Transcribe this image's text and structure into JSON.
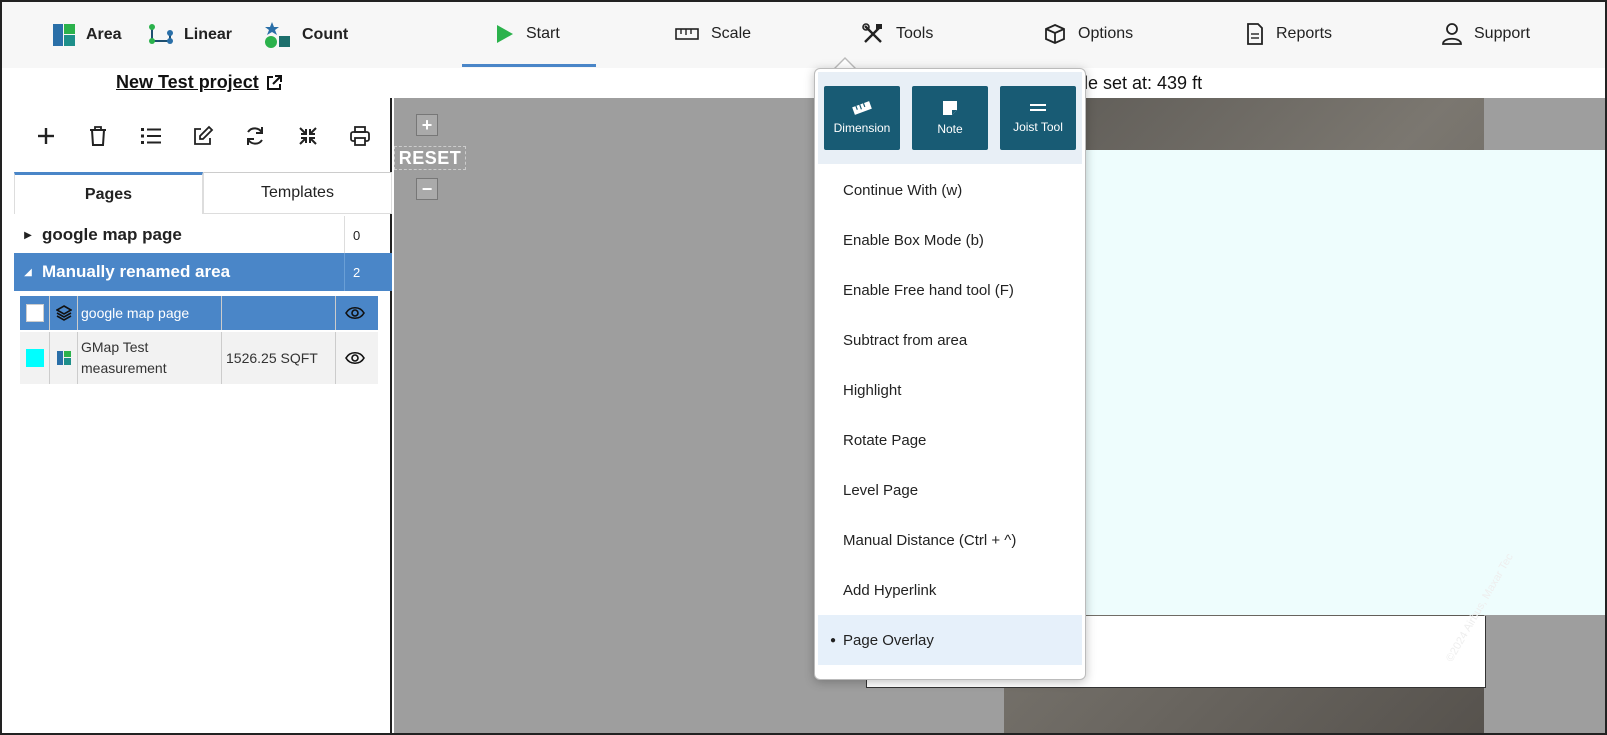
{
  "measure_tabs": [
    {
      "label": "Area",
      "icon": "area-icon"
    },
    {
      "label": "Linear",
      "icon": "linear-icon"
    },
    {
      "label": "Count",
      "icon": "count-icon"
    }
  ],
  "menu_tabs": [
    {
      "label": "Start",
      "icon": "play-icon"
    },
    {
      "label": "Scale",
      "icon": "ruler-icon"
    },
    {
      "label": "Tools",
      "icon": "tools-icon"
    },
    {
      "label": "Options",
      "icon": "cube-icon"
    },
    {
      "label": "Reports",
      "icon": "document-icon"
    },
    {
      "label": "Support",
      "icon": "user-icon"
    }
  ],
  "project": {
    "title": "New Test project",
    "scale_text": "le set at: 439 ft"
  },
  "sidebar": {
    "tabs": {
      "pages": "Pages",
      "templates": "Templates"
    },
    "groups": [
      {
        "name": "google map page",
        "count": "0"
      },
      {
        "name": "Manually renamed area",
        "count": "2"
      }
    ],
    "items": [
      {
        "name": "google map page",
        "value": ""
      },
      {
        "name": "GMap Test measurement",
        "value": "1526.25 SQFT"
      }
    ]
  },
  "canvas": {
    "reset_label": "RESET",
    "plus": "+",
    "minus": "−",
    "watermark": "©2024 Airbus, Maxar Tec"
  },
  "tools_menu": {
    "buttons": [
      {
        "label": "Dimension",
        "icon": "ruler-icon"
      },
      {
        "label": "Note",
        "icon": "note-icon"
      },
      {
        "label": "Joist Tool",
        "icon": "joist-icon"
      }
    ],
    "items": [
      "Continue With (w)",
      "Enable Box Mode (b)",
      "Enable Free hand tool (F)",
      "Subtract from area",
      "Highlight",
      "Rotate Page",
      "Level Page",
      "Manual Distance (Ctrl + ^)",
      "Add Hyperlink",
      "Page Overlay"
    ],
    "selected": "Page Overlay"
  },
  "colors": {
    "accent": "#4a86c8",
    "tool_button": "#185b74",
    "start_green": "#2bb24c",
    "cyan": "#00ffff"
  }
}
